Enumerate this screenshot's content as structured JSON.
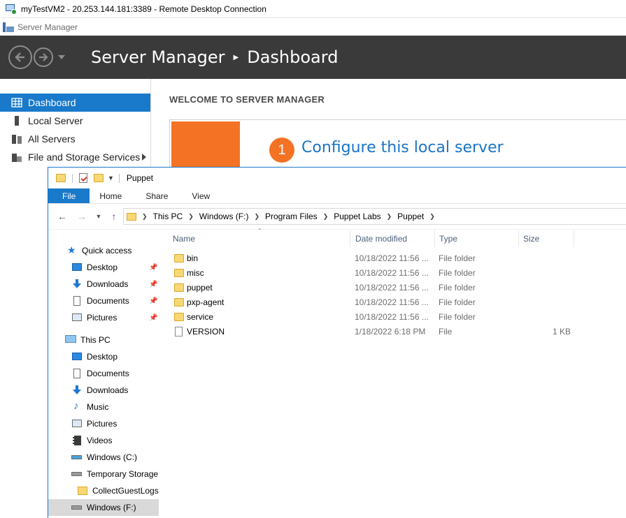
{
  "rdp": {
    "title": "myTestVM2 - 20.253.144.181:3389 - Remote Desktop Connection"
  },
  "server_manager": {
    "caption": "Server Manager",
    "breadcrumb": {
      "app": "Server Manager",
      "page": "Dashboard"
    },
    "sidebar": [
      {
        "label": "Dashboard",
        "icon": "dashboard-icon",
        "active": true
      },
      {
        "label": "Local Server",
        "icon": "server-icon"
      },
      {
        "label": "All Servers",
        "icon": "servers-icon"
      },
      {
        "label": "File and Storage Services",
        "icon": "storage-icon",
        "has_submenu": true
      }
    ],
    "welcome_heading": "WELCOME TO SERVER MANAGER",
    "quick_start": {
      "step_number": "1",
      "link": "Configure this local server"
    },
    "accent_color": "#f47223",
    "selection_color": "#1979ca"
  },
  "explorer": {
    "title": "Puppet",
    "ribbon_tabs": [
      "File",
      "Home",
      "Share",
      "View"
    ],
    "address_path": [
      "This PC",
      "Windows (F:)",
      "Program Files",
      "Puppet Labs",
      "Puppet"
    ],
    "columns": {
      "name": "Name",
      "date": "Date modified",
      "type": "Type",
      "size": "Size"
    },
    "files": [
      {
        "name": "bin",
        "date": "10/18/2022 11:56 ...",
        "type": "File folder",
        "size": "",
        "kind": "folder"
      },
      {
        "name": "misc",
        "date": "10/18/2022 11:56 ...",
        "type": "File folder",
        "size": "",
        "kind": "folder"
      },
      {
        "name": "puppet",
        "date": "10/18/2022 11:56 ...",
        "type": "File folder",
        "size": "",
        "kind": "folder"
      },
      {
        "name": "pxp-agent",
        "date": "10/18/2022 11:56 ...",
        "type": "File folder",
        "size": "",
        "kind": "folder"
      },
      {
        "name": "service",
        "date": "10/18/2022 11:56 ...",
        "type": "File folder",
        "size": "",
        "kind": "folder"
      },
      {
        "name": "VERSION",
        "date": "1/18/2022 6:18 PM",
        "type": "File",
        "size": "1 KB",
        "kind": "file"
      }
    ],
    "nav": {
      "quick_access": {
        "label": "Quick access",
        "items": [
          "Desktop",
          "Downloads",
          "Documents",
          "Pictures"
        ]
      },
      "this_pc": {
        "label": "This PC",
        "items": [
          "Desktop",
          "Documents",
          "Downloads",
          "Music",
          "Pictures",
          "Videos",
          "Windows (C:)",
          "Temporary Storage",
          "CollectGuestLogsTemp",
          "Windows (F:)"
        ]
      }
    }
  }
}
